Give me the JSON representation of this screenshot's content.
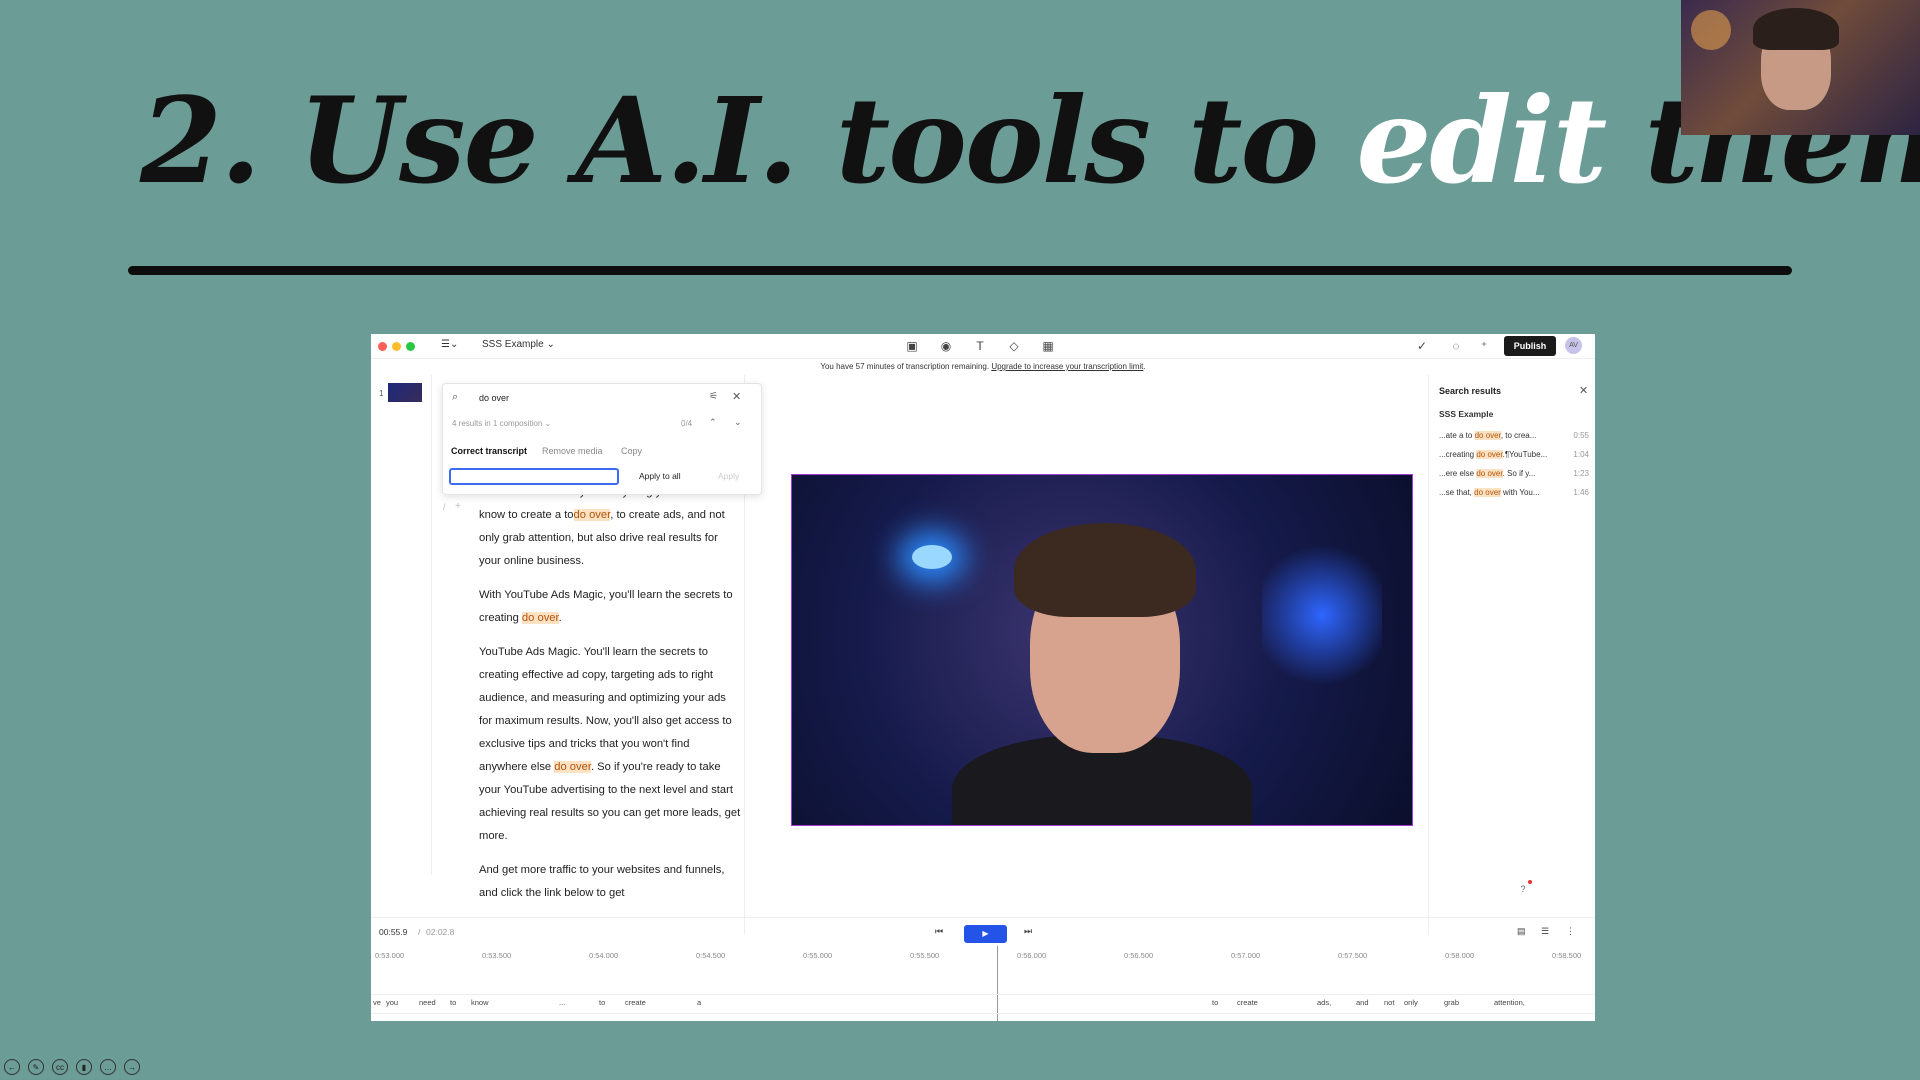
{
  "slide": {
    "title_part1": "2. Use A.I. tools to ",
    "title_highlight": "edit",
    "title_part2": " them"
  },
  "colors": {
    "slide_bg": "#6b9c95",
    "accent_blue": "#2453e8",
    "highlight": "#fbe2c3"
  },
  "titlebar": {
    "project": "SSS Example",
    "publish": "Publish",
    "avatar_initials": "AV"
  },
  "banner": {
    "text": "You have 57 minutes of transcription remaining.",
    "link": "Upgrade to increase your transcription limit"
  },
  "scenes": [
    {
      "number": "1"
    }
  ],
  "search_popup": {
    "query": "do over",
    "meta": "4 results in 1 composition",
    "count": "0/4",
    "tabs": [
      "Correct transcript",
      "Remove media",
      "Copy"
    ],
    "input_value": "",
    "apply_all": "Apply to all",
    "apply": "Apply"
  },
  "script_paragraphs": [
    [
      "course that teaches you everything you need to know to create a to",
      {
        "hl": "do over"
      },
      ", to create ads, and not only grab attention, but also drive real results for your online business."
    ],
    [
      "With YouTube Ads Magic, you'll learn the secrets to creating ",
      {
        "hl": "do over"
      },
      "."
    ],
    [
      "YouTube Ads Magic. You'll learn the secrets to creating effective ad copy, targeting ads to right audience, and measuring and optimizing your ads for maximum results. Now, you'll also get access to exclusive tips and tricks that you won't find anywhere else ",
      {
        "hl": "do over"
      },
      ". So if you're ready to take your YouTube advertising to the next level and start achieving real results so you can get more leads, get more."
    ],
    [
      "And get more traffic to your websites and funnels, and click the link below to get"
    ]
  ],
  "search_results": {
    "title": "Search results",
    "composition": "SSS Example",
    "items": [
      {
        "pre": "...ate a to ",
        "hl": "do over",
        "post": ", to crea...",
        "time": "0:55"
      },
      {
        "pre": "...creating ",
        "hl": "do over",
        "post": ".¶YouTube...",
        "time": "1:04"
      },
      {
        "pre": "...ere else ",
        "hl": "do over",
        "post": ". So if y...",
        "time": "1:23"
      },
      {
        "pre": "...se that, ",
        "hl": "do over",
        "post": " with You...",
        "time": "1:46"
      }
    ]
  },
  "transport": {
    "current": "00:55.9",
    "total": "02:02.8"
  },
  "ruler_ticks": [
    "0:53.000",
    "0:53.500",
    "0:54.000",
    "0:54.500",
    "0:55.000",
    "0:55.500",
    "0:56.000",
    "0:56.500",
    "0:57.000",
    "0:57.500",
    "0:58.000",
    "0:58.500"
  ],
  "timeline_words": [
    "ve",
    "you",
    "need",
    "to",
    "know",
    "...",
    "to",
    "create",
    "a",
    "to",
    "create",
    "ads,",
    "and",
    "not",
    "only",
    "grab",
    "attention,"
  ]
}
